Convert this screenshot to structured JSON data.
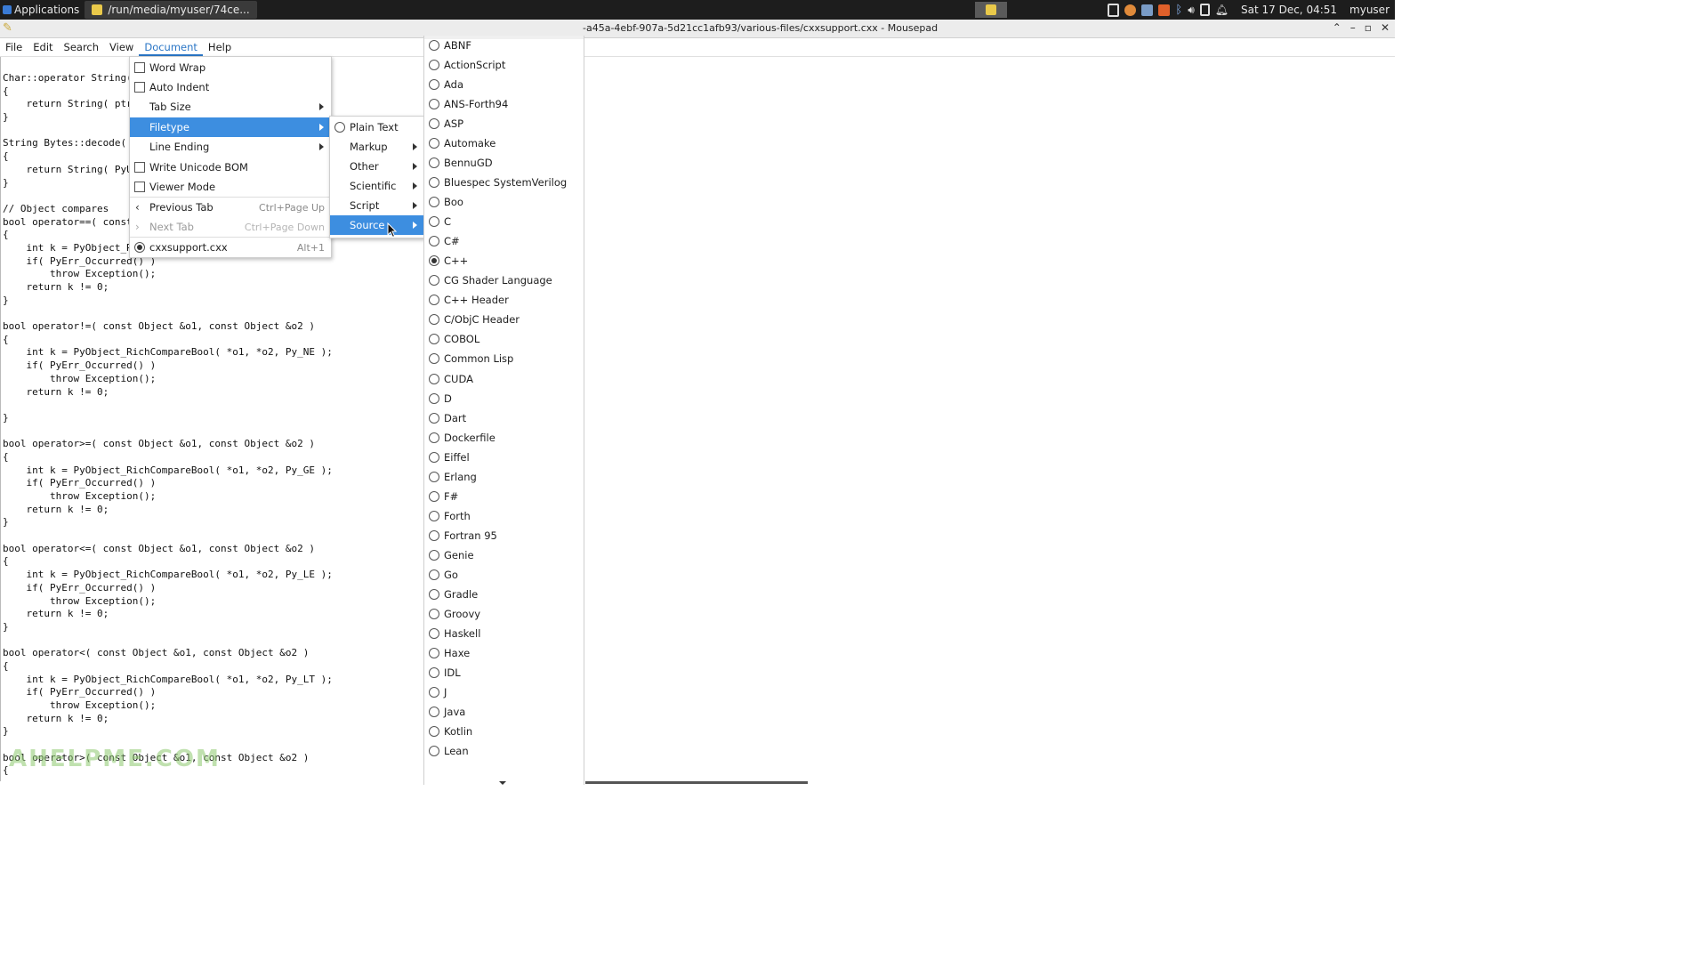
{
  "panel": {
    "applications_label": "Applications",
    "task_label": "/run/media/myuser/74ce...",
    "datetime": "Sat 17 Dec, 04:51",
    "user": "myuser"
  },
  "window": {
    "title": "-a45a-4ebf-907a-5d21cc1afb93/various-files/cxxsupport.cxx - Mousepad"
  },
  "menubar": [
    "File",
    "Edit",
    "Search",
    "View",
    "Document",
    "Help"
  ],
  "document_menu": {
    "word_wrap": "Word Wrap",
    "auto_indent": "Auto Indent",
    "tab_size": "Tab Size",
    "filetype": "Filetype",
    "line_ending": "Line Ending",
    "write_unicode_bom": "Write Unicode BOM",
    "viewer_mode": "Viewer Mode",
    "previous_tab": "Previous Tab",
    "previous_tab_accel": "Ctrl+Page Up",
    "next_tab": "Next Tab",
    "next_tab_accel": "Ctrl+Page Down",
    "open_file": "cxxsupport.cxx",
    "open_file_accel": "Alt+1"
  },
  "filetype_menu": {
    "plain_text": "Plain Text",
    "markup": "Markup",
    "other": "Other",
    "scientific": "Scientific",
    "script": "Script",
    "source": "Source"
  },
  "source_languages": [
    "ABNF",
    "ActionScript",
    "Ada",
    "ANS-Forth94",
    "ASP",
    "Automake",
    "BennuGD",
    "Bluespec SystemVerilog",
    "Boo",
    "C",
    "C#",
    "C++",
    "CG Shader Language",
    "C++ Header",
    "C/ObjC Header",
    "COBOL",
    "Common Lisp",
    "CUDA",
    "D",
    "Dart",
    "Dockerfile",
    "Eiffel",
    "Erlang",
    "F#",
    "Forth",
    "Fortran 95",
    "Genie",
    "Go",
    "Gradle",
    "Groovy",
    "Haskell",
    "Haxe",
    "IDL",
    "J",
    "Java",
    "Kotlin",
    "Lean"
  ],
  "selected_language": "C++",
  "editor": {
    "code": "Char::operator String()\n{\n    return String( ptr\n}\n\nString Bytes::decode(\n{\n    return String( PyU\n}\n\n// Object compares\nbool operator==( const\n{\n    int k = PyObject_R\n    if( PyErr_Occurred() )\n        throw Exception();\n    return k != 0;\n}\n\nbool operator!=( const Object &o1, const Object &o2 )\n{\n    int k = PyObject_RichCompareBool( *o1, *o2, Py_NE );\n    if( PyErr_Occurred() )\n        throw Exception();\n    return k != 0;\n\n}\n\nbool operator>=( const Object &o1, const Object &o2 )\n{\n    int k = PyObject_RichCompareBool( *o1, *o2, Py_GE );\n    if( PyErr_Occurred() )\n        throw Exception();\n    return k != 0;\n}\n\nbool operator<=( const Object &o1, const Object &o2 )\n{\n    int k = PyObject_RichCompareBool( *o1, *o2, Py_LE );\n    if( PyErr_Occurred() )\n        throw Exception();\n    return k != 0;\n}\n\nbool operator<( const Object &o1, const Object &o2 )\n{\n    int k = PyObject_RichCompareBool( *o1, *o2, Py_LT );\n    if( PyErr_Occurred() )\n        throw Exception();\n    return k != 0;\n}\n\nbool operator>( const Object &o1, const Object &o2 )\n{"
  },
  "watermark": "AHELPME.COM",
  "colors": {
    "accent": "#3d8ee0",
    "panel": "#1d1d1d",
    "menu_active": "#2a76c6"
  }
}
